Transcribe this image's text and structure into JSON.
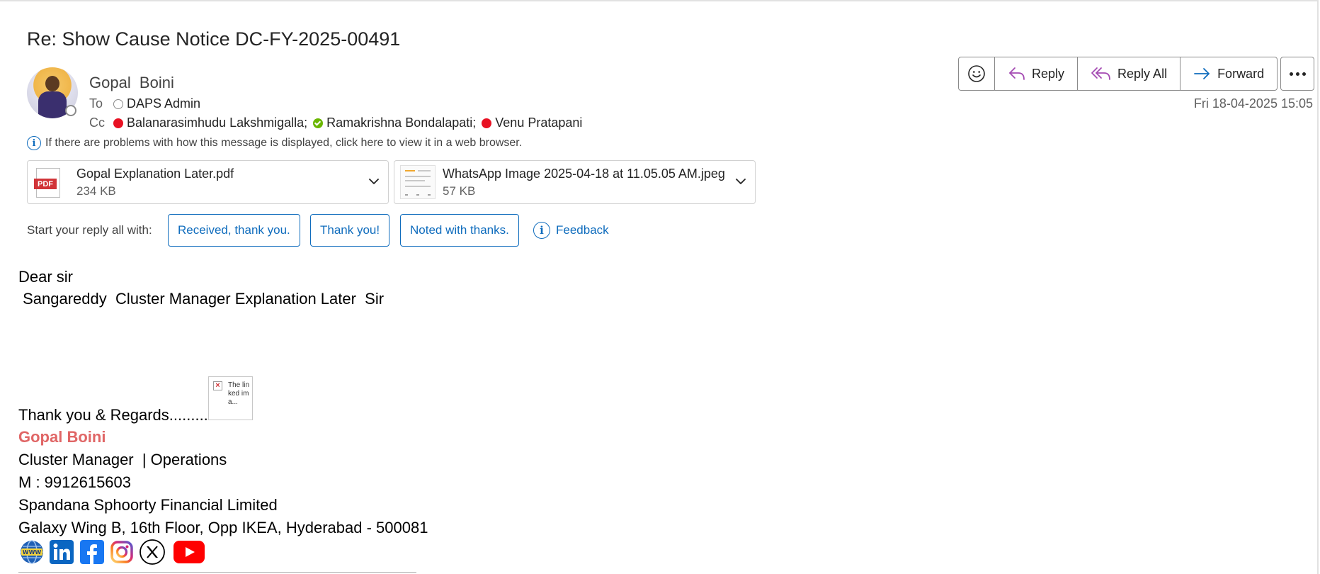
{
  "message": {
    "subject": "Re: Show Cause Notice DC-FY-2025-00491",
    "sender": "Gopal  Boini",
    "to_label": "To",
    "cc_label": "Cc",
    "to": [
      {
        "name": "DAPS Admin",
        "status": "unknown"
      }
    ],
    "cc": [
      {
        "name": "Balanarasimhudu Lakshmigalla;",
        "status": "busy"
      },
      {
        "name": "Ramakrishna Bondalapati;",
        "status": "available"
      },
      {
        "name": "Venu Pratapani",
        "status": "busy"
      }
    ],
    "datetime": "Fri 18-04-2025 15:05",
    "info_notice": "If there are problems with how this message is displayed, click here to view it in a web browser."
  },
  "toolbar": {
    "emoji_icon": "smiley-icon",
    "reply_label": "Reply",
    "reply_all_label": "Reply All",
    "forward_label": "Forward",
    "more_icon": "ellipsis-icon"
  },
  "attachments": [
    {
      "name": "Gopal Explanation Later.pdf",
      "size": "234 KB",
      "icon": "PDF"
    },
    {
      "name": "WhatsApp Image 2025-04-18 at 11.05.05 AM.jpeg",
      "size": "57 KB",
      "icon": "image-thumbnail"
    }
  ],
  "quick_reply": {
    "label": "Start your reply all with:",
    "chips": [
      "Received, thank you.",
      "Thank you!",
      "Noted with thanks."
    ],
    "feedback_label": "Feedback"
  },
  "body": {
    "greeting": "Dear sir",
    "line1": " Sangareddy  Cluster Manager Explanation Later  Sir",
    "thanks": "Thank you & Regards..........",
    "broken_image_alt": "The linked ima..."
  },
  "signature": {
    "name": "Gopal Boini",
    "title": "Cluster Manager  | Operations",
    "mobile": "M : 9912615603",
    "company": "Spandana Sphoorty Financial Limited",
    "address": "Galaxy Wing B, 16th Floor, Opp IKEA, Hyderabad - 500081",
    "social_icons": [
      "www-globe-icon",
      "linkedin-icon",
      "facebook-icon",
      "instagram-icon",
      "x-icon",
      "youtube-icon"
    ]
  },
  "colors": {
    "accent": "#0f6cbd",
    "reply_icon": "#a44ab2",
    "forward_icon": "#0f6cbd",
    "signature_name": "#e06666",
    "presence_busy": "#e81123",
    "presence_available": "#6bb700"
  }
}
